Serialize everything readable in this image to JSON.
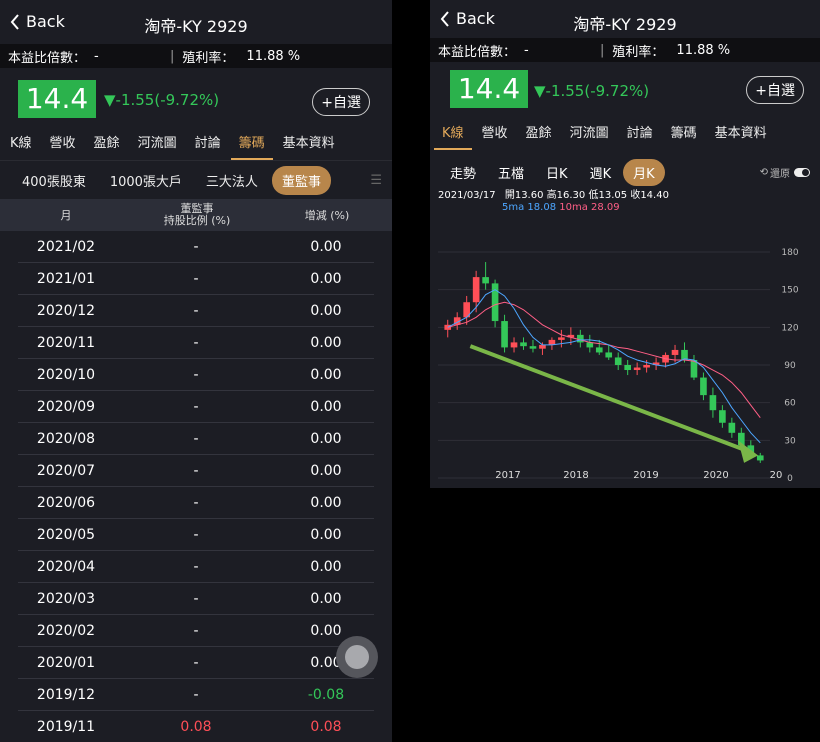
{
  "stock_title": "淘帝-KY 2929",
  "back_label": "Back",
  "pe_label": "本益比倍數：",
  "pe_value": "-",
  "yield_label": "殖利率：",
  "yield_value": "11.88 %",
  "price": "14.4",
  "change": "▼-1.55(-9.72%)",
  "add_watch": "+自選",
  "tabs": [
    "K線",
    "營收",
    "盈餘",
    "河流圖",
    "討論",
    "籌碼",
    "基本資料"
  ],
  "left": {
    "active_tab": "籌碼",
    "subtabs": [
      "400張股東",
      "1000張大戶",
      "三大法人",
      "董監事"
    ],
    "active_subtab": "董監事",
    "table": {
      "headers": [
        "月",
        "董監事\n持股比例 (%)",
        "增減 (%)"
      ],
      "rows": [
        [
          "2021/02",
          "-",
          "0.00"
        ],
        [
          "2021/01",
          "-",
          "0.00"
        ],
        [
          "2020/12",
          "-",
          "0.00"
        ],
        [
          "2020/11",
          "-",
          "0.00"
        ],
        [
          "2020/10",
          "-",
          "0.00"
        ],
        [
          "2020/09",
          "-",
          "0.00"
        ],
        [
          "2020/08",
          "-",
          "0.00"
        ],
        [
          "2020/07",
          "-",
          "0.00"
        ],
        [
          "2020/06",
          "-",
          "0.00"
        ],
        [
          "2020/05",
          "-",
          "0.00"
        ],
        [
          "2020/04",
          "-",
          "0.00"
        ],
        [
          "2020/03",
          "-",
          "0.00"
        ],
        [
          "2020/02",
          "-",
          "0.00"
        ],
        [
          "2020/01",
          "-",
          "0.00"
        ],
        [
          "2019/12",
          "-",
          "-0.08"
        ],
        [
          "2019/11",
          "0.08",
          "0.08"
        ]
      ]
    }
  },
  "right": {
    "active_tab": "K線",
    "chart_tabs": [
      "走勢",
      "五檔",
      "日K",
      "週K",
      "月K"
    ],
    "active_chart_tab": "月K",
    "restore_label": "還原",
    "ohlc": {
      "date": "2021/03/17",
      "open_label": "開",
      "open": "13.60",
      "high_label": "高",
      "high": "16.30",
      "low_label": "低",
      "low": "13.05",
      "close_label": "收",
      "close": "14.40",
      "ma5_label": "5ma",
      "ma5": "18.08",
      "ma10_label": "10ma",
      "ma10": "28.09"
    },
    "colors": {
      "up": "#ff4f57",
      "down": "#34c759",
      "ma5": "#4da6ff",
      "ma10": "#ff5f86",
      "trend_arrow": "#7ab648"
    }
  },
  "chart_data": {
    "type": "candlestick",
    "x_ticks": [
      "2017",
      "2018",
      "2019",
      "2020",
      "20"
    ],
    "y_ticks": [
      180,
      150,
      120,
      90,
      60,
      30,
      0
    ],
    "ylim": [
      0,
      180
    ],
    "candles": [
      [
        118,
        126,
        112,
        122
      ],
      [
        122,
        132,
        118,
        128
      ],
      [
        128,
        145,
        122,
        140
      ],
      [
        140,
        165,
        132,
        160
      ],
      [
        160,
        172,
        150,
        155
      ],
      [
        155,
        158,
        120,
        125
      ],
      [
        125,
        130,
        100,
        104
      ],
      [
        104,
        112,
        100,
        108
      ],
      [
        108,
        112,
        102,
        105
      ],
      [
        105,
        110,
        100,
        103
      ],
      [
        103,
        108,
        98,
        106
      ],
      [
        106,
        112,
        102,
        110
      ],
      [
        110,
        118,
        104,
        112
      ],
      [
        112,
        120,
        106,
        114
      ],
      [
        114,
        118,
        104,
        108
      ],
      [
        108,
        114,
        100,
        104
      ],
      [
        104,
        110,
        98,
        100
      ],
      [
        100,
        106,
        94,
        96
      ],
      [
        96,
        100,
        86,
        90
      ],
      [
        90,
        94,
        82,
        86
      ],
      [
        86,
        92,
        82,
        88
      ],
      [
        88,
        94,
        84,
        90
      ],
      [
        90,
        96,
        86,
        92
      ],
      [
        92,
        100,
        88,
        98
      ],
      [
        98,
        106,
        92,
        102
      ],
      [
        102,
        108,
        92,
        94
      ],
      [
        94,
        98,
        78,
        80
      ],
      [
        80,
        84,
        62,
        66
      ],
      [
        66,
        72,
        48,
        54
      ],
      [
        54,
        58,
        40,
        44
      ],
      [
        44,
        48,
        32,
        36
      ],
      [
        36,
        40,
        22,
        26
      ],
      [
        26,
        30,
        15,
        18
      ],
      [
        18,
        20,
        12,
        14
      ]
    ],
    "ma5": [
      120,
      124,
      128,
      136,
      146,
      150,
      145,
      135,
      122,
      112,
      106,
      106,
      107,
      108,
      110,
      110,
      109,
      106,
      102,
      97,
      94,
      92,
      90,
      89,
      91,
      95,
      94,
      88,
      78,
      68,
      56,
      46,
      36,
      28
    ],
    "ma10": [
      120,
      122,
      124,
      128,
      134,
      138,
      140,
      138,
      134,
      128,
      122,
      118,
      114,
      112,
      110,
      108,
      107,
      106,
      104,
      103,
      101,
      99,
      97,
      95,
      94,
      94,
      93,
      90,
      86,
      82,
      76,
      68,
      58,
      48
    ]
  }
}
